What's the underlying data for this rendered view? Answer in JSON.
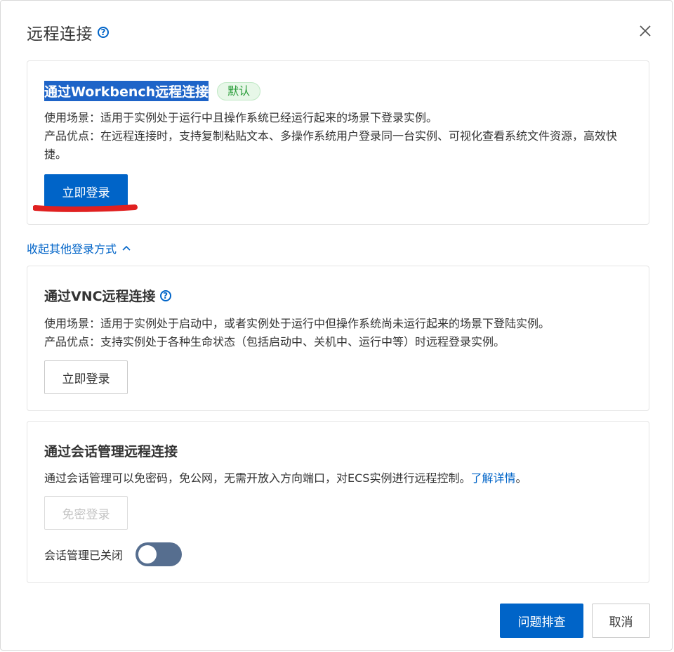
{
  "dialog": {
    "title": "远程连接",
    "help_glyph": "?"
  },
  "workbench": {
    "title": "通过Workbench远程连接",
    "badge": "默认",
    "usage": "使用场景：适用于实例处于运行中且操作系统已经运行起来的场景下登录实例。",
    "advantage": "产品优点：在远程连接时，支持复制粘贴文本、多操作系统用户登录同一台实例、可视化查看系统文件资源，高效快捷。",
    "login_label": "立即登录"
  },
  "collapse_link": "收起其他登录方式",
  "vnc": {
    "title": "通过VNC远程连接",
    "usage": "使用场景：适用于实例处于启动中，或者实例处于运行中但操作系统尚未运行起来的场景下登陆实例。",
    "advantage": "产品优点：支持实例处于各种生命状态（包括启动中、关机中、运行中等）时远程登录实例。",
    "login_label": "立即登录"
  },
  "session": {
    "title": "通过会话管理远程连接",
    "desc": "通过会话管理可以免密码，免公网，无需开放入方向端口，对ECS实例进行远程控制。",
    "learn_more": "了解详情",
    "desc_end": "。",
    "login_label": "免密登录",
    "toggle_label": "会话管理已关闭",
    "toggle_on": false
  },
  "footer": {
    "troubleshoot_label": "问题排查",
    "cancel_label": "取消"
  },
  "colors": {
    "primary": "#0064c8",
    "annotation": "#e02020",
    "badge_green": "#2a9d3a"
  }
}
